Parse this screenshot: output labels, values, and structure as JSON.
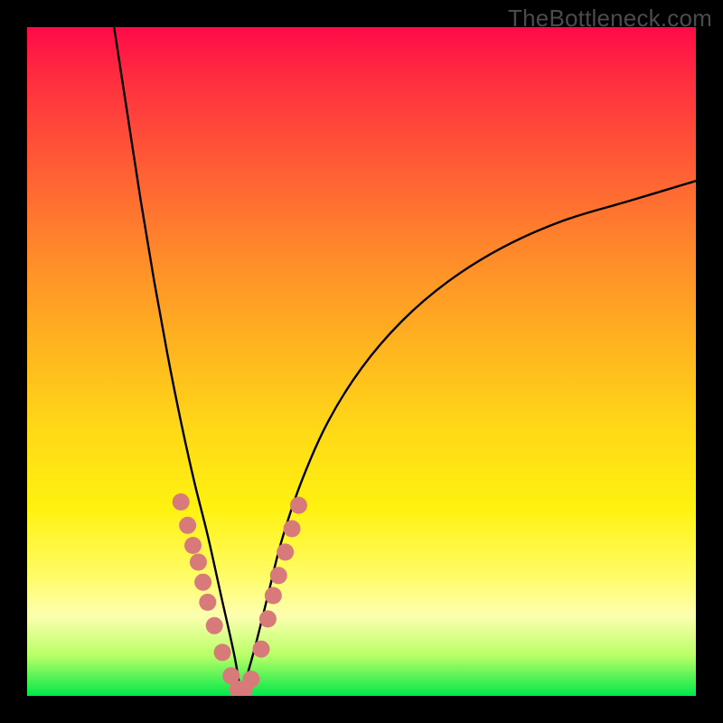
{
  "watermark": "TheBottleneck.com",
  "chart_data": {
    "type": "line",
    "title": "",
    "xlabel": "",
    "ylabel": "",
    "xlim": [
      0,
      100
    ],
    "ylim": [
      0,
      100
    ],
    "series": [
      {
        "name": "left-arm",
        "x": [
          13,
          15,
          17,
          19,
          21,
          23,
          25,
          27,
          29,
          31,
          32
        ],
        "values": [
          100,
          87,
          74,
          62,
          51,
          41,
          32,
          24,
          15,
          6,
          0
        ]
      },
      {
        "name": "right-arm",
        "x": [
          32,
          34,
          36,
          38,
          41,
          45,
          50,
          56,
          63,
          71,
          80,
          90,
          100
        ],
        "values": [
          0,
          7,
          15,
          23,
          32,
          41,
          49,
          56,
          62,
          67,
          71,
          74,
          77
        ]
      }
    ],
    "scatter_points": {
      "name": "data-points",
      "color": "#d87a7a",
      "x": [
        23.0,
        24.0,
        24.8,
        25.6,
        26.3,
        27.0,
        28.0,
        29.2,
        30.5,
        31.5,
        32.5,
        33.5,
        35.0,
        36.0,
        36.8,
        37.6,
        38.6,
        39.6,
        40.6
      ],
      "values": [
        29.0,
        25.5,
        22.5,
        20.0,
        17.0,
        14.0,
        10.5,
        6.5,
        3.0,
        1.0,
        1.0,
        2.5,
        7.0,
        11.5,
        15.0,
        18.0,
        21.5,
        25.0,
        28.5
      ]
    },
    "gradient_stops": [
      {
        "pos": 0.0,
        "color": "#ff0a48"
      },
      {
        "pos": 0.08,
        "color": "#ff2f3f"
      },
      {
        "pos": 0.2,
        "color": "#ff5a36"
      },
      {
        "pos": 0.34,
        "color": "#ff8a2a"
      },
      {
        "pos": 0.48,
        "color": "#ffb51f"
      },
      {
        "pos": 0.6,
        "color": "#ffd817"
      },
      {
        "pos": 0.72,
        "color": "#fff210"
      },
      {
        "pos": 0.82,
        "color": "#fffc66"
      },
      {
        "pos": 0.88,
        "color": "#fdffb0"
      },
      {
        "pos": 0.94,
        "color": "#b8ff66"
      },
      {
        "pos": 1.0,
        "color": "#00e84a"
      }
    ]
  }
}
